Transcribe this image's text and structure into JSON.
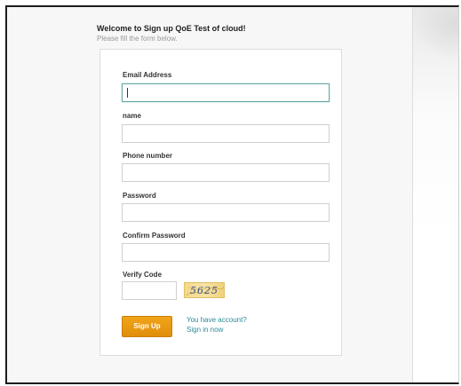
{
  "header": {
    "title": "Welcome to Sign up QoE Test of cloud!",
    "subtitle": "Please fill the form below."
  },
  "form": {
    "email_label": "Email Address",
    "email_value": "",
    "name_label": "name",
    "name_value": "",
    "phone_label": "Phone number",
    "phone_value": "",
    "password_label": "Password",
    "password_value": "",
    "confirm_label": "Confirm Password",
    "confirm_value": "",
    "verify_label": "Verify Code",
    "verify_value": "",
    "captcha_text": "5625",
    "submit_label": "Sign Up",
    "account_text": "You have account?",
    "signin_label": "Sign in now"
  },
  "colors": {
    "accent": "#e8960f",
    "link": "#2b8a9a",
    "focus_border": "#6aa8a8"
  }
}
